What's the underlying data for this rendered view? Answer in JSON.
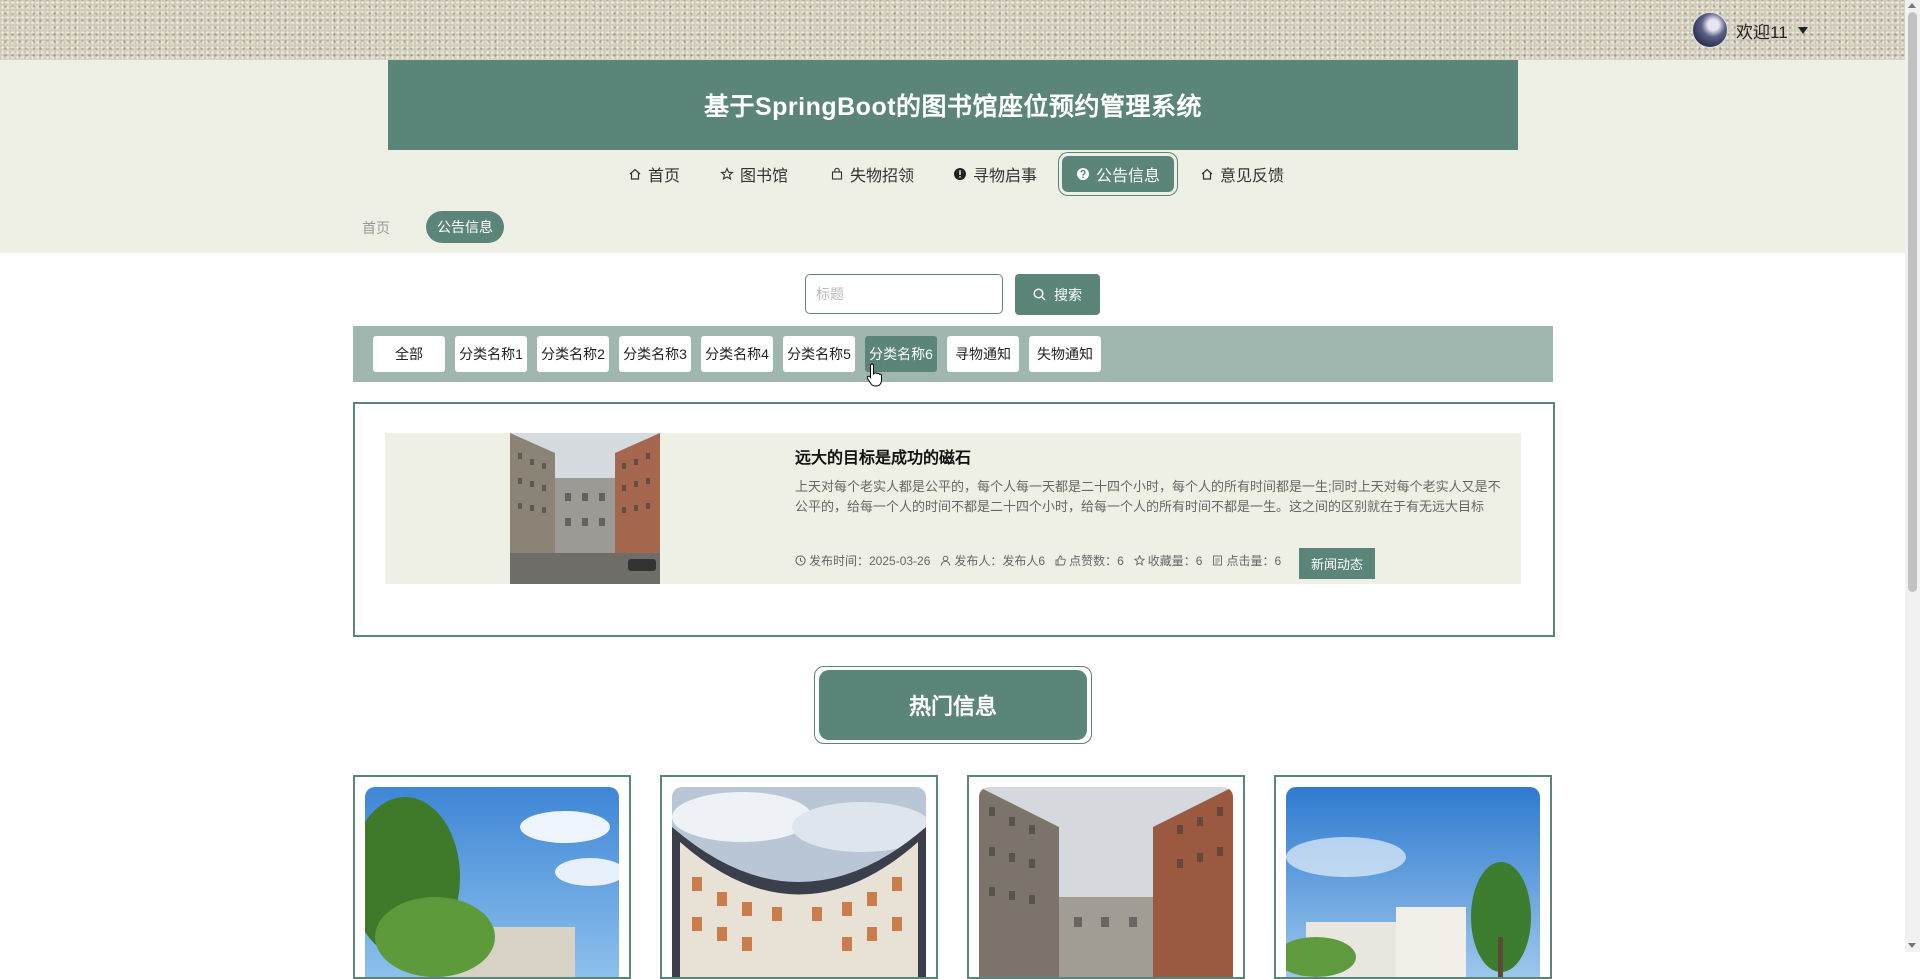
{
  "user": {
    "greeting": "欢迎11"
  },
  "site": {
    "title": "基于SpringBoot的图书馆座位预约管理系统"
  },
  "nav": [
    {
      "label": "首页",
      "icon": "home-icon"
    },
    {
      "label": "图书馆",
      "icon": "star-icon"
    },
    {
      "label": "失物招领",
      "icon": "bag-icon"
    },
    {
      "label": "寻物启事",
      "icon": "alert-icon"
    },
    {
      "label": "公告信息",
      "icon": "question-icon",
      "active": true
    },
    {
      "label": "意见反馈",
      "icon": "home-icon"
    }
  ],
  "breadcrumb": {
    "home": "首页",
    "current": "公告信息"
  },
  "search": {
    "placeholder": "标题",
    "button_label": "搜索"
  },
  "categories": [
    {
      "label": "全部"
    },
    {
      "label": "分类名称1"
    },
    {
      "label": "分类名称2"
    },
    {
      "label": "分类名称3"
    },
    {
      "label": "分类名称4"
    },
    {
      "label": "分类名称5"
    },
    {
      "label": "分类名称6",
      "active": true
    },
    {
      "label": "寻物通知"
    },
    {
      "label": "失物通知"
    }
  ],
  "news": {
    "title": "远大的目标是成功的磁石",
    "description": "上天对每个老实人都是公平的，每个人每一天都是二十四个小时，每个人的所有时间都是一生;同时上天对每个老实人又是不公平的，给每一个人的时间不都是二十四个小时，给每一个人的所有时间不都是一生。这之间的区别就在于有无远大目标",
    "publish_time": "发布时间：2025-03-26",
    "publisher": "发布人：发布人6",
    "likes": "点赞数：6",
    "favorites": "收藏量：6",
    "clicks": "点击量：6",
    "tag": "新闻动态"
  },
  "hot": {
    "title": "热门信息"
  },
  "colors": {
    "primary": "#5b8579",
    "band": "#eef0e5",
    "category_bar": "#a0b7af"
  }
}
